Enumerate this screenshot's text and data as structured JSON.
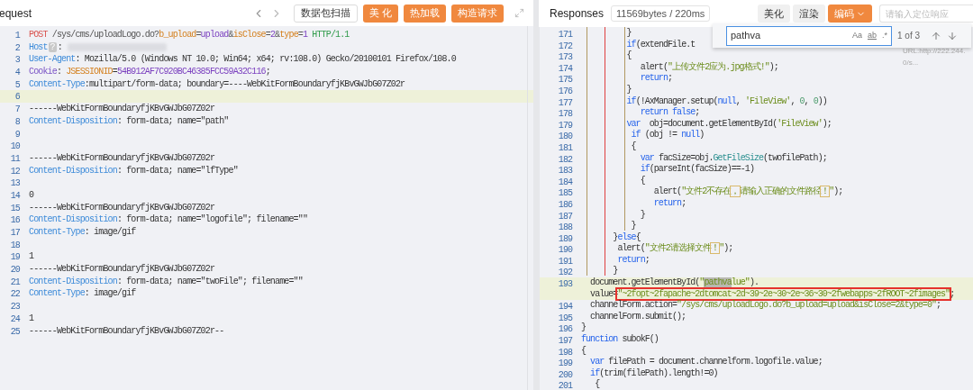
{
  "request": {
    "title": "equest",
    "buttons": [
      {
        "label": "数据包扫描",
        "kind": "outline"
      },
      {
        "label": "美 化",
        "kind": "primary"
      },
      {
        "label": "热加载",
        "kind": "primary"
      },
      {
        "label": "构造请求",
        "kind": "primary"
      }
    ],
    "lines": [
      {
        "no": "1",
        "current": false,
        "tokens": [
          {
            "text": "POST",
            "kind": "method"
          },
          {
            "text": " /sys/cms/uploadLogo.do?",
            "kind": "path"
          },
          {
            "text": "b_upload",
            "kind": "key"
          },
          {
            "text": "=",
            "kind": "path"
          },
          {
            "text": "upload",
            "kind": "value"
          },
          {
            "text": "&",
            "kind": "path"
          },
          {
            "text": "isClose",
            "kind": "key"
          },
          {
            "text": "=",
            "kind": "path"
          },
          {
            "text": "2",
            "kind": "value"
          },
          {
            "text": "&",
            "kind": "path"
          },
          {
            "text": "type",
            "kind": "key"
          },
          {
            "text": "=",
            "kind": "path"
          },
          {
            "text": "1",
            "kind": "value"
          },
          {
            "text": " HTTP/1.1",
            "kind": "version"
          }
        ]
      },
      {
        "no": "2",
        "current": false,
        "tokens": [
          {
            "text": "Host",
            "kind": "header"
          },
          {
            "text": "?",
            "kind": "badge"
          },
          {
            "text": ":",
            "kind": "plain"
          },
          {
            "kind": "redacted"
          }
        ]
      },
      {
        "no": "3",
        "current": false,
        "tokens": [
          {
            "text": "User-Agent",
            "kind": "header"
          },
          {
            "text": ": Mozilla/5.0 (Windows NT 10.0; Win64; x64; rv:108.0) Gecko/20100101 Firefox/108.0",
            "kind": "plain"
          }
        ]
      },
      {
        "no": "4",
        "current": false,
        "tokens": [
          {
            "text": "Cookie",
            "kind": "cookie"
          },
          {
            "text": ": ",
            "kind": "plain"
          },
          {
            "text": "JSESSIONID",
            "kind": "key"
          },
          {
            "text": "=",
            "kind": "plain"
          },
          {
            "text": "54B912AF7C920BC46385FCC59A32C116",
            "kind": "value"
          },
          {
            "text": ";",
            "kind": "plain"
          }
        ]
      },
      {
        "no": "5",
        "current": false,
        "tokens": [
          {
            "text": "Content-Type",
            "kind": "header"
          },
          {
            "text": ":multipart/form-data; boundary=----WebKitFormBoundaryfjKBvGWJbG07Z02r",
            "kind": "plain"
          }
        ]
      },
      {
        "no": "6",
        "current": true
      },
      {
        "no": "7",
        "current": false,
        "tokens": [
          {
            "text": "------WebKitFormBoundaryfjKBvGWJbG07Z02r",
            "kind": "plain"
          }
        ]
      },
      {
        "no": "8",
        "current": false,
        "tokens": [
          {
            "text": "Content-Disposition",
            "kind": "header"
          },
          {
            "text": ": form-data; name=\"path\"",
            "kind": "plain"
          }
        ]
      },
      {
        "no": "9",
        "current": false
      },
      {
        "no": "10",
        "current": false
      },
      {
        "no": "11",
        "current": false,
        "tokens": [
          {
            "text": "------WebKitFormBoundaryfjKBvGWJbG07Z02r",
            "kind": "plain"
          }
        ]
      },
      {
        "no": "12",
        "current": false,
        "tokens": [
          {
            "text": "Content-Disposition",
            "kind": "header"
          },
          {
            "text": ": form-data; name=\"lfType\"",
            "kind": "plain"
          }
        ]
      },
      {
        "no": "13",
        "current": false
      },
      {
        "no": "14",
        "current": false,
        "tokens": [
          {
            "text": "0",
            "kind": "plain"
          }
        ]
      },
      {
        "no": "15",
        "current": false,
        "tokens": [
          {
            "text": "------WebKitFormBoundaryfjKBvGWJbG07Z02r",
            "kind": "plain"
          }
        ]
      },
      {
        "no": "16",
        "current": false,
        "tokens": [
          {
            "text": "Content-Disposition",
            "kind": "header"
          },
          {
            "text": ": form-data; name=\"logofile\"; filename=\"\"",
            "kind": "plain"
          }
        ]
      },
      {
        "no": "17",
        "current": false,
        "tokens": [
          {
            "text": "Content-Type",
            "kind": "header"
          },
          {
            "text": ": image/gif",
            "kind": "plain"
          }
        ]
      },
      {
        "no": "18",
        "current": false
      },
      {
        "no": "19",
        "current": false,
        "tokens": [
          {
            "text": "1",
            "kind": "plain"
          }
        ]
      },
      {
        "no": "20",
        "current": false,
        "tokens": [
          {
            "text": "------WebKitFormBoundaryfjKBvGWJbG07Z02r",
            "kind": "plain"
          }
        ]
      },
      {
        "no": "21",
        "current": false,
        "tokens": [
          {
            "text": "Content-Disposition",
            "kind": "header"
          },
          {
            "text": ": form-data; name=\"twoFile\"; filename=\"\"",
            "kind": "plain"
          }
        ]
      },
      {
        "no": "22",
        "current": false,
        "tokens": [
          {
            "text": "Content-Type",
            "kind": "header"
          },
          {
            "text": ": image/gif",
            "kind": "plain"
          }
        ]
      },
      {
        "no": "23",
        "current": false
      },
      {
        "no": "24",
        "current": false,
        "tokens": [
          {
            "text": "1",
            "kind": "plain"
          }
        ]
      },
      {
        "no": "25",
        "current": false,
        "tokens": [
          {
            "text": "------WebKitFormBoundaryfjKBvGWJbG07Z02r--",
            "kind": "plain"
          }
        ]
      }
    ]
  },
  "response": {
    "title": "Responses",
    "stats": "11569bytes / 220ms",
    "buttons": [
      {
        "label": "美化",
        "kind": "plain"
      },
      {
        "label": "渲染",
        "kind": "plain"
      },
      {
        "label": "编码",
        "kind": "dropdown"
      }
    ],
    "locate_placeholder": "请输入定位响应",
    "find": {
      "value": "pathva",
      "options": [
        {
          "label": "Aa",
          "on": false
        },
        {
          "label": "ab",
          "on": false
        },
        {
          "label": ".*",
          "on": false
        }
      ],
      "count": "1 of 3"
    },
    "side_text": [
      "URL:http://222.244.",
      "0/s..."
    ],
    "lines": [
      {
        "no": "171",
        "current": false,
        "tokens": [
          {
            "text": "          }",
            "kind": "plain"
          }
        ]
      },
      {
        "no": "172",
        "current": false,
        "tokens": [
          {
            "text": "          if",
            "kind": "keyword"
          },
          {
            "text": "(extendFile.t",
            "kind": "plain"
          }
        ]
      },
      {
        "no": "173",
        "current": false,
        "tokens": [
          {
            "text": "          {",
            "kind": "plain"
          }
        ]
      },
      {
        "no": "174",
        "current": false,
        "tokens": [
          {
            "text": "             alert(",
            "kind": "plain"
          },
          {
            "text": "\"上传文件2应为.jpg格式!\"",
            "kind": "string"
          },
          {
            "text": ");",
            "kind": "plain"
          }
        ]
      },
      {
        "no": "175",
        "current": false,
        "tokens": [
          {
            "text": "             return",
            "kind": "keyword"
          },
          {
            "text": ";",
            "kind": "plain"
          }
        ]
      },
      {
        "no": "176",
        "current": false,
        "tokens": [
          {
            "text": "          }",
            "kind": "plain"
          }
        ]
      },
      {
        "no": "177",
        "current": false,
        "tokens": [
          {
            "text": "          if",
            "kind": "keyword"
          },
          {
            "text": "(!AxManager.setup(",
            "kind": "plain"
          },
          {
            "text": "null",
            "kind": "keyword"
          },
          {
            "text": ", ",
            "kind": "plain"
          },
          {
            "text": "'FileView'",
            "kind": "string"
          },
          {
            "text": ", ",
            "kind": "plain"
          },
          {
            "text": "0",
            "kind": "number"
          },
          {
            "text": ", ",
            "kind": "plain"
          },
          {
            "text": "0",
            "kind": "number"
          },
          {
            "text": "))",
            "kind": "plain"
          }
        ]
      },
      {
        "no": "178",
        "current": false,
        "tokens": [
          {
            "text": "             return false",
            "kind": "keyword"
          },
          {
            "text": ";",
            "kind": "plain"
          }
        ]
      },
      {
        "no": "179",
        "current": false,
        "tokens": [
          {
            "text": "          var",
            "kind": "keyword"
          },
          {
            "text": "  obj=document.getElementById(",
            "kind": "plain"
          },
          {
            "text": "'FileView'",
            "kind": "string"
          },
          {
            "text": ");",
            "kind": "plain"
          }
        ]
      },
      {
        "no": "180",
        "current": false,
        "tokens": [
          {
            "text": "           if",
            "kind": "keyword"
          },
          {
            "text": " (obj != ",
            "kind": "plain"
          },
          {
            "text": "null",
            "kind": "keyword"
          },
          {
            "text": ")",
            "kind": "plain"
          }
        ]
      },
      {
        "no": "181",
        "current": false,
        "tokens": [
          {
            "text": "           {",
            "kind": "plain"
          }
        ]
      },
      {
        "no": "182",
        "current": false,
        "tokens": [
          {
            "text": "             var",
            "kind": "keyword"
          },
          {
            "text": " facSize=obj.",
            "kind": "plain"
          },
          {
            "text": "GetFileSize",
            "kind": "func"
          },
          {
            "text": "(twofilePath);",
            "kind": "plain"
          }
        ]
      },
      {
        "no": "183",
        "current": false,
        "tokens": [
          {
            "text": "             if",
            "kind": "keyword"
          },
          {
            "text": "(parseInt(facSize)==-1)",
            "kind": "plain"
          }
        ]
      },
      {
        "no": "184",
        "current": false,
        "tokens": [
          {
            "text": "             {",
            "kind": "plain"
          }
        ]
      },
      {
        "no": "185",
        "current": false,
        "tokens": [
          {
            "text": "                alert(",
            "kind": "plain"
          },
          {
            "text": "\"文件2不存在",
            "kind": "string"
          },
          {
            "text": "，",
            "kind": "flagged"
          },
          {
            "text": "请输入正确的文件路径",
            "kind": "string"
          },
          {
            "text": "！",
            "kind": "flagged"
          },
          {
            "text": "\"",
            "kind": "string"
          },
          {
            "text": ");",
            "kind": "plain"
          }
        ]
      },
      {
        "no": "186",
        "current": false,
        "tokens": [
          {
            "text": "                return",
            "kind": "keyword"
          },
          {
            "text": ";",
            "kind": "plain"
          }
        ]
      },
      {
        "no": "187",
        "current": false,
        "tokens": [
          {
            "text": "             }",
            "kind": "plain"
          }
        ]
      },
      {
        "no": "188",
        "current": false,
        "tokens": [
          {
            "text": "           }",
            "kind": "plain"
          }
        ]
      },
      {
        "no": "189",
        "current": false,
        "tokens": [
          {
            "text": "       }",
            "kind": "plain"
          },
          {
            "text": "else",
            "kind": "keyword"
          },
          {
            "text": "{",
            "kind": "plain"
          }
        ]
      },
      {
        "no": "190",
        "current": false,
        "tokens": [
          {
            "text": "        alert(",
            "kind": "plain"
          },
          {
            "text": "\"文件2请选择文件",
            "kind": "string"
          },
          {
            "text": "！",
            "kind": "flagged"
          },
          {
            "text": "\"",
            "kind": "string"
          },
          {
            "text": ");",
            "kind": "plain"
          }
        ]
      },
      {
        "no": "191",
        "current": false,
        "tokens": [
          {
            "text": "        return",
            "kind": "keyword"
          },
          {
            "text": ";",
            "kind": "plain"
          }
        ]
      },
      {
        "no": "192",
        "current": false,
        "tokens": [
          {
            "text": "       }",
            "kind": "plain"
          }
        ]
      },
      {
        "no": "193",
        "current": true,
        "tokens": [
          {
            "text": "  document.getElementById(",
            "kind": "plain"
          },
          {
            "text": "\"",
            "kind": "string"
          },
          {
            "text": "pathva",
            "kind": "match"
          },
          {
            "text": "lue\"",
            "kind": "string"
          },
          {
            "text": ").",
            "kind": "plain"
          }
        ],
        "wrap": [
          {
            "text": "  value=",
            "kind": "plain"
          },
          {
            "text": "\"~2fopt~2fapache~2dtomcat~2d~39~2e~30~2e~36~30~2fwebapps~2fROOT~2fimages\"",
            "kind": "boxed"
          },
          {
            "text": ";",
            "kind": "plain"
          }
        ]
      },
      {
        "no": "194",
        "current": false,
        "tokens": [
          {
            "text": "  channelForm.action=",
            "kind": "plain"
          },
          {
            "text": "\"/sys/cms/uploadLogo.do?b_upload=upload&isClose=2&type=0\"",
            "kind": "string"
          },
          {
            "text": ";",
            "kind": "plain"
          }
        ]
      },
      {
        "no": "195",
        "current": false,
        "tokens": [
          {
            "text": "  channelForm.submit();",
            "kind": "plain"
          }
        ]
      },
      {
        "no": "196",
        "current": false,
        "tokens": [
          {
            "text": "}",
            "kind": "plain"
          }
        ]
      },
      {
        "no": "197",
        "current": false,
        "tokens": [
          {
            "text": "function",
            "kind": "keyword"
          },
          {
            "text": " subokF()",
            "kind": "plain"
          }
        ]
      },
      {
        "no": "198",
        "current": false,
        "tokens": [
          {
            "text": "{",
            "kind": "plain"
          }
        ]
      },
      {
        "no": "199",
        "current": false,
        "tokens": [
          {
            "text": "  var",
            "kind": "keyword"
          },
          {
            "text": " filePath = document.channelform.logofile.value;",
            "kind": "plain"
          }
        ]
      },
      {
        "no": "200",
        "current": false,
        "tokens": [
          {
            "text": "  if",
            "kind": "keyword"
          },
          {
            "text": "(trim(filePath).length!=0)",
            "kind": "plain"
          }
        ]
      },
      {
        "no": "201",
        "current": false,
        "tokens": [
          {
            "text": "   {",
            "kind": "plain"
          }
        ]
      }
    ]
  }
}
